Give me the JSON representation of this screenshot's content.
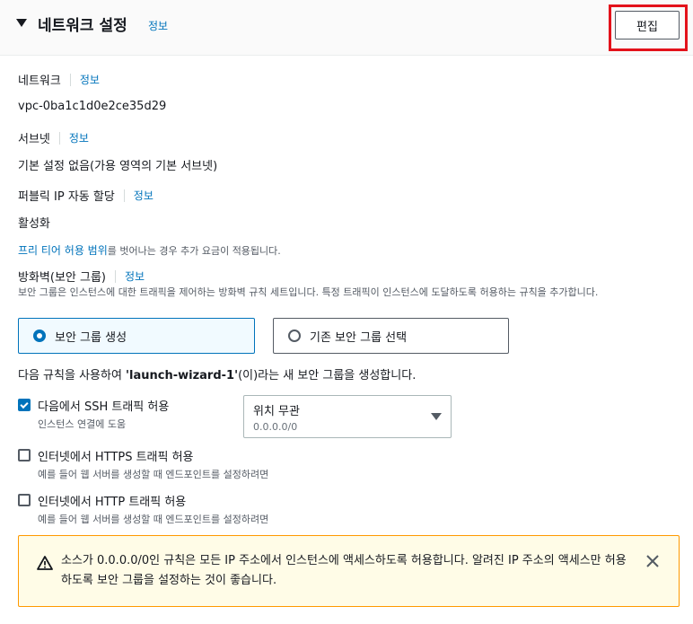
{
  "section": {
    "title": "네트워크 설정",
    "info": "정보",
    "edit_label": "편집"
  },
  "network": {
    "label": "네트워크",
    "info": "정보",
    "value": "vpc-0ba1c1d0e2ce35d29"
  },
  "subnet": {
    "label": "서브넷",
    "info": "정보",
    "value": "기본 설정 없음(가용 영역의 기본 서브넷)"
  },
  "public_ip": {
    "label": "퍼블릭 IP 자동 할당",
    "info": "정보",
    "value": "활성화"
  },
  "notice": {
    "link": "프리 티어 허용 범위",
    "text": "를 벗어나는 경우 추가 요금이 적용됩니다."
  },
  "firewall": {
    "label": "방화벽(보안 그룹)",
    "info": "정보",
    "description": "보안 그룹은 인스턴스에 대한 트래픽을 제어하는 방화벽 규칙 세트입니다. 특정 트래픽이 인스턴스에 도달하도록 허용하는 규칙을 추가합니다.",
    "options": [
      "보안 그룹 생성",
      "기존 보안 그룹 선택"
    ],
    "selected_index": 0
  },
  "rule_text": {
    "prefix": "다음 규칙을 사용하여 ",
    "name": "'launch-wizard-1'",
    "suffix": "(이)라는 새 보안 그룹을 생성합니다."
  },
  "rules": [
    {
      "label": "다음에서 SSH 트래픽 허용",
      "desc": "인스턴스 연결에 도움",
      "checked": true
    },
    {
      "label": "인터넷에서 HTTPS 트래픽 허용",
      "desc": "예를 들어 웹 서버를 생성할 때 엔드포인트를 설정하려면",
      "checked": false
    },
    {
      "label": "인터넷에서 HTTP 트래픽 허용",
      "desc": "예를 들어 웹 서버를 생성할 때 엔드포인트를 설정하려면",
      "checked": false
    }
  ],
  "source_select": {
    "value": "위치 무관",
    "sub": "0.0.0.0/0"
  },
  "alert": {
    "text": "소스가 0.0.0.0/0인 규칙은 모든 IP 주소에서 인스턴스에 액세스하도록 허용합니다. 알려진 IP 주소의 액세스만 허용하도록 보안 그룹을 설정하는 것이 좋습니다."
  },
  "colors": {
    "link": "#0073bb",
    "highlight": "#e3121b",
    "alert_bg": "#fffce7",
    "alert_border": "#ff9900"
  }
}
